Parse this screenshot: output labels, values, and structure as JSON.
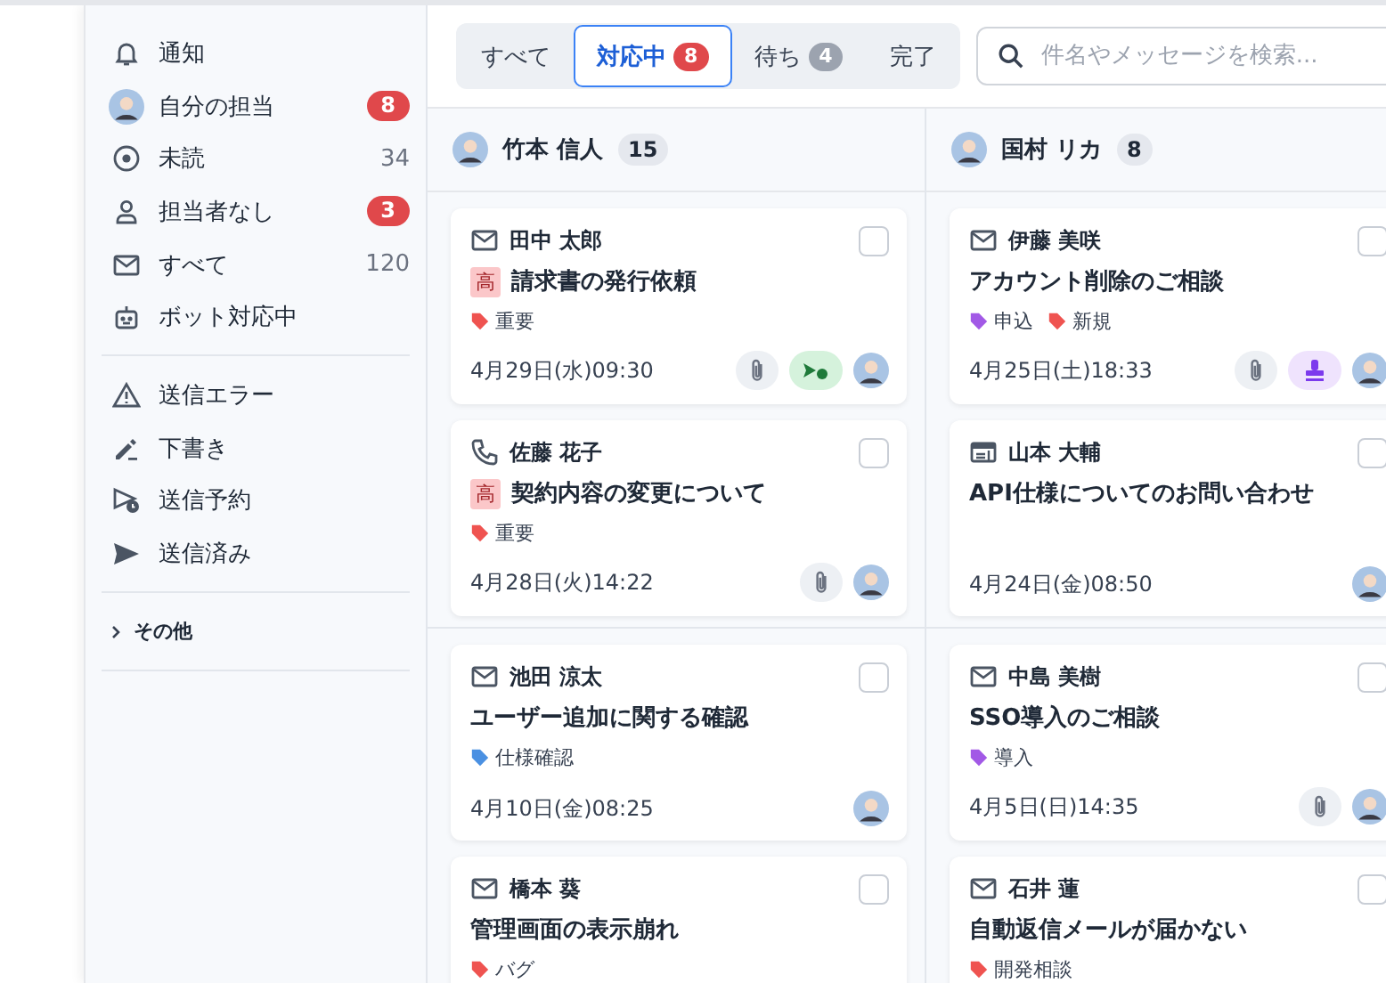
{
  "sidebar": {
    "sections": [
      {
        "items": [
          {
            "kind": "bell",
            "label": "通知"
          },
          {
            "kind": "avatar",
            "label": "自分の担当",
            "count": "8",
            "alert": true
          },
          {
            "kind": "unread",
            "label": "未読",
            "count": "34",
            "alert": false
          },
          {
            "kind": "person",
            "label": "担当者なし",
            "count": "3",
            "alert": true
          },
          {
            "kind": "mail",
            "label": "すべて",
            "count": "120",
            "alert": false
          },
          {
            "kind": "bot",
            "label": "ボット対応中"
          }
        ]
      },
      {
        "items": [
          {
            "kind": "warning",
            "label": "送信エラー"
          },
          {
            "kind": "pen",
            "label": "下書き"
          },
          {
            "kind": "scheduled",
            "label": "送信予約"
          },
          {
            "kind": "send",
            "label": "送信済み"
          }
        ]
      }
    ],
    "more": {
      "label": "その他",
      "expanded": false
    }
  },
  "tabs": [
    {
      "label": "すべて",
      "selected": false
    },
    {
      "label": "対応中",
      "count": "8",
      "selected": true
    },
    {
      "label": "待ち",
      "count": "4",
      "selected": false
    },
    {
      "label": "完了",
      "selected": false
    }
  ],
  "search": {
    "placeholder": "件名やメッセージを検索..."
  },
  "columns": [
    {
      "assignee": "竹本 信人",
      "count": "15",
      "groups": [
        [
          {
            "kind": "mail",
            "sender": "田中 太郎",
            "priority": "高",
            "subject": "請求書の発行依頼",
            "tags": [
              {
                "label": "重要",
                "color": "#ef5350"
              }
            ],
            "date": "4月29日(水)09:30",
            "attachment": true,
            "status": {
              "kind": "bot"
            },
            "checked": false
          },
          {
            "kind": "phone",
            "sender": "佐藤 花子",
            "priority": "高",
            "subject": "契約内容の変更について",
            "tags": [
              {
                "label": "重要",
                "color": "#ef5350"
              }
            ],
            "date": "4月28日(火)14:22",
            "attachment": true,
            "checked": false
          }
        ],
        [
          {
            "kind": "mail",
            "sender": "池田 涼太",
            "subject": "ユーザー追加に関する確認",
            "tags": [
              {
                "label": "仕様確認",
                "color": "#4a90e2"
              }
            ],
            "date": "4月10日(金)08:25",
            "attachment": false,
            "checked": false
          },
          {
            "kind": "mail",
            "sender": "橋本 葵",
            "subject": "管理画面の表示崩れ",
            "tags": [
              {
                "label": "バグ",
                "color": "#ef5350"
              }
            ],
            "checked": false
          }
        ]
      ]
    },
    {
      "assignee": "国村 リカ",
      "count": "8",
      "groups": [
        [
          {
            "kind": "mail",
            "sender": "伊藤 美咲",
            "subject": "アカウント削除のご相談",
            "tags": [
              {
                "label": "申込",
                "color": "#a259e6"
              },
              {
                "label": "新規",
                "color": "#ef5350"
              }
            ],
            "date": "4月25日(土)18:33",
            "attachment": true,
            "status": {
              "kind": "stamp"
            },
            "checked": false
          },
          {
            "kind": "chat",
            "sender": "山本 大輔",
            "subject": "API仕様についてのお問い合わせ",
            "date": "4月24日(金)08:50",
            "attachment": false,
            "checked": false
          }
        ],
        [
          {
            "kind": "mail",
            "sender": "中島 美樹",
            "subject": "SSO導入のご相談",
            "tags": [
              {
                "label": "導入",
                "color": "#a259e6"
              }
            ],
            "date": "4月5日(日)14:35",
            "attachment": true,
            "checked": false
          },
          {
            "kind": "mail",
            "sender": "石井 蓮",
            "subject": "自動返信メールが届かない",
            "tags": [
              {
                "label": "開発相談",
                "color": "#ef5350"
              }
            ],
            "checked": false
          }
        ]
      ]
    }
  ]
}
